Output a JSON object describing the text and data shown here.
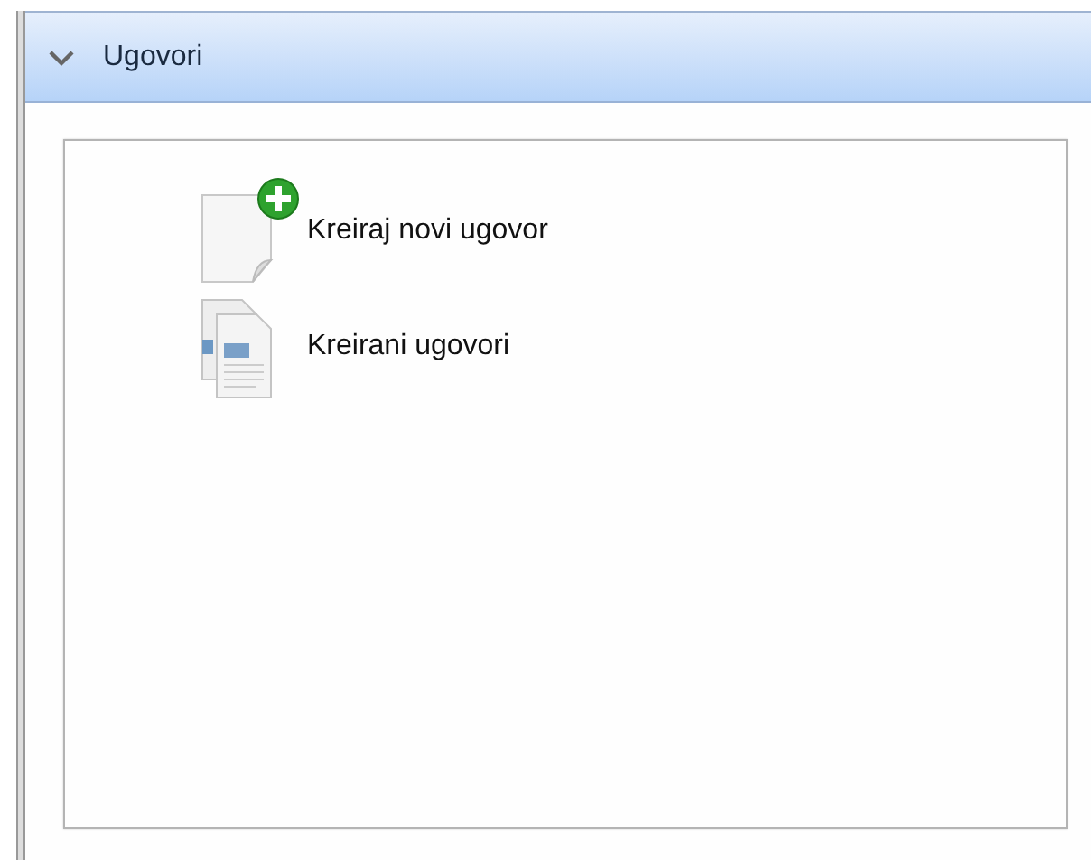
{
  "panel": {
    "title": "Ugovori",
    "expanded": true,
    "items": [
      {
        "kind": "new",
        "label": "Kreiraj novi ugovor"
      },
      {
        "kind": "list",
        "label": "Kreirani ugovori"
      }
    ]
  }
}
